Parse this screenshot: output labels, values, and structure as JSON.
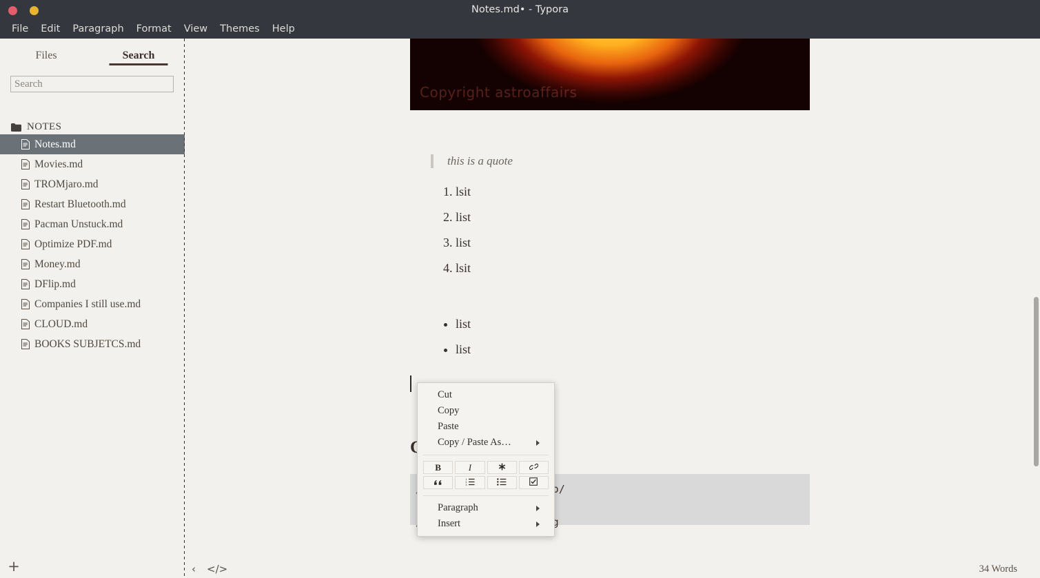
{
  "window": {
    "title": "Notes.md• - Typora",
    "controls": [
      {
        "name": "close",
        "color": "#e35d6a"
      },
      {
        "name": "minimize",
        "color": "#e9b330"
      }
    ]
  },
  "menubar": {
    "items": [
      "File",
      "Edit",
      "Paragraph",
      "Format",
      "View",
      "Themes",
      "Help"
    ]
  },
  "sidebar": {
    "tabs": [
      {
        "label": "Files",
        "active": false
      },
      {
        "label": "Search",
        "active": true
      }
    ],
    "search": {
      "value": "",
      "placeholder": "Search"
    },
    "folder": {
      "label": "NOTES",
      "icon": "folder-icon"
    },
    "files": [
      {
        "label": "Notes.md",
        "selected": true
      },
      {
        "label": "Movies.md",
        "selected": false
      },
      {
        "label": "TROMjaro.md",
        "selected": false
      },
      {
        "label": "Restart Bluetooth.md",
        "selected": false
      },
      {
        "label": "Pacman Unstuck.md",
        "selected": false
      },
      {
        "label": "Optimize PDF.md",
        "selected": false
      },
      {
        "label": "Money.md",
        "selected": false
      },
      {
        "label": "DFlip.md",
        "selected": false
      },
      {
        "label": "Companies I still use.md",
        "selected": false
      },
      {
        "label": "CLOUD.md",
        "selected": false
      },
      {
        "label": "BOOKS SUBJETCS.md",
        "selected": false
      }
    ],
    "add_button": "+"
  },
  "document": {
    "hero_image": {
      "watermark": "Copyright astroaffairs",
      "alt": "solar eclipse photo"
    },
    "quote": "this is a quote",
    "ordered_list": [
      "lsit",
      "list",
      "list",
      "lsit"
    ],
    "unordered_list": [
      "list",
      "list"
    ],
    "heading": "C",
    "code_lines": [
      "/manjaro-tools/buildiso/",
      "",
      "/manjaro-tools/buildpkg"
    ]
  },
  "context_menu": {
    "items_top": [
      {
        "label": "Cut",
        "submenu": false
      },
      {
        "label": "Copy",
        "submenu": false
      },
      {
        "label": "Paste",
        "submenu": false
      },
      {
        "label": "Copy / Paste As…",
        "submenu": true
      }
    ],
    "format_buttons": [
      {
        "glyph": "B",
        "name": "bold-button",
        "style": "b"
      },
      {
        "glyph": "I",
        "name": "italic-button",
        "style": "i"
      },
      {
        "glyph": "✱",
        "name": "asterisk-button",
        "style": ""
      },
      {
        "glyph": "🔗",
        "name": "link-icon",
        "style": ""
      },
      {
        "glyph": "❝",
        "name": "blockquote-icon",
        "style": ""
      },
      {
        "glyph": "⒈☰",
        "name": "ordered-list-icon",
        "style": ""
      },
      {
        "glyph": "☰",
        "name": "unordered-list-icon",
        "style": ""
      },
      {
        "glyph": "☑",
        "name": "task-list-icon",
        "style": ""
      }
    ],
    "items_bottom": [
      {
        "label": "Paragraph",
        "submenu": true
      },
      {
        "label": "Insert",
        "submenu": true
      }
    ]
  },
  "statusbar": {
    "back_icon": "‹",
    "source_icon": "</>",
    "word_count": "34 Words"
  },
  "colors": {
    "titlebar": "#34373d",
    "background": "#f2f1ed",
    "selection": "#6b7277",
    "code_bg": "#d9d9d9",
    "accent": "#463731"
  }
}
